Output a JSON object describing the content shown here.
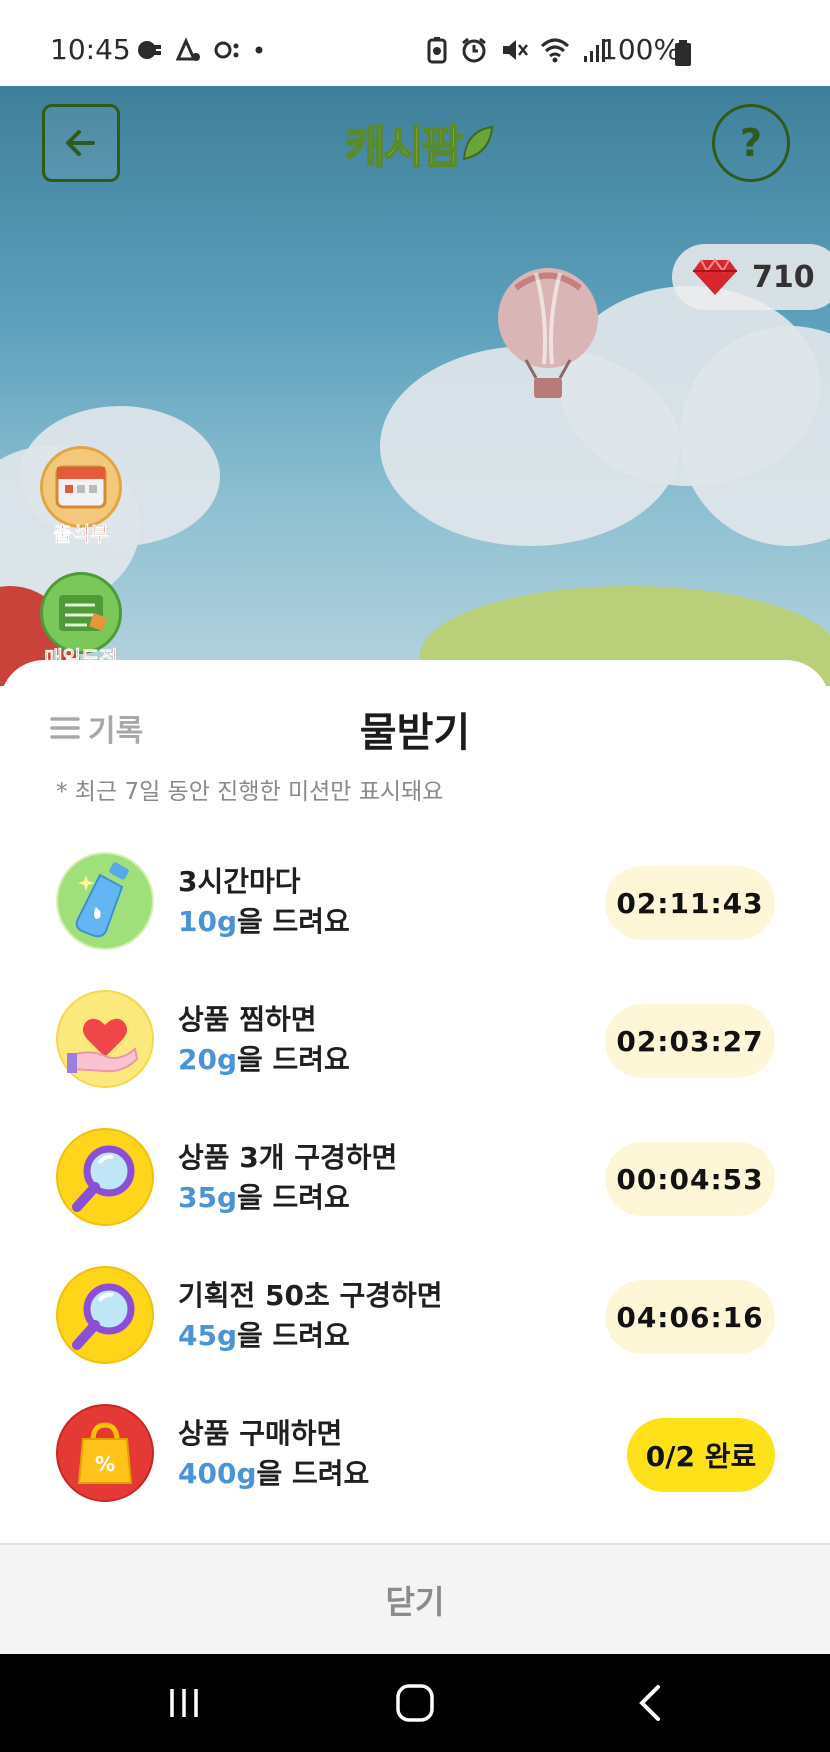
{
  "status_bar": {
    "time": "10:45",
    "battery": "100%",
    "left_icons": [
      "usb-icon",
      "delivery-icon",
      "key-icon",
      "dot-icon"
    ],
    "right_icons": [
      "battery-saver-icon",
      "alarm-icon",
      "mute-icon",
      "wifi-icon",
      "signal-icon",
      "battery-icon"
    ]
  },
  "game": {
    "logo": "캐시팜",
    "gems": "710",
    "side_buttons": [
      "출석부",
      "매일도전"
    ]
  },
  "sheet": {
    "history_label": "기록",
    "title": "물받기",
    "notice": "* 최근 7일 동안 진행한 미션만 표시돼요",
    "missions": [
      {
        "title": "3시간마다",
        "amount": "10g",
        "reward_suffix": "을 드려요",
        "status": "02:11:43",
        "icon": "water-bottle-icon"
      },
      {
        "title": "상품 찜하면",
        "amount": "20g",
        "reward_suffix": "을 드려요",
        "status": "02:03:27",
        "icon": "heart-hand-icon"
      },
      {
        "title": "상품 3개 구경하면",
        "amount": "35g",
        "reward_suffix": "을 드려요",
        "status": "00:04:53",
        "icon": "magnifier-icon"
      },
      {
        "title": "기획전 50초 구경하면",
        "amount": "45g",
        "reward_suffix": "을 드려요",
        "status": "04:06:16",
        "icon": "magnifier-icon"
      },
      {
        "title": "상품 구매하면",
        "amount": "400g",
        "reward_suffix": "을 드려요",
        "status": "0/2 완료",
        "icon": "shopping-bag-icon"
      }
    ],
    "close_label": "닫기"
  },
  "colors": {
    "accent_blue": "#4a93d6",
    "timer_bg": "#fdf7d8",
    "done_bg": "#ffe11a",
    "logo_green": "#5a8a2e"
  }
}
